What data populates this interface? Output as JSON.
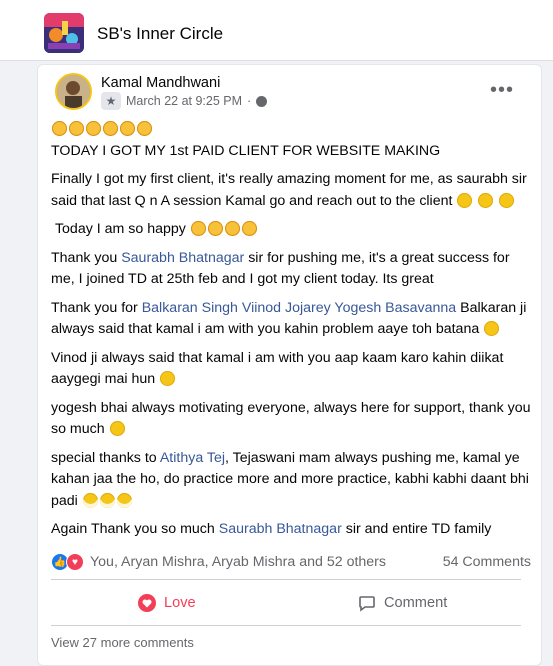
{
  "group": {
    "name": "SB's Inner Circle"
  },
  "post": {
    "author": "Kamal Mandhwani",
    "date": "March 22 at 9:25 PM",
    "meta_separator": "·",
    "more_label": "•••",
    "paragraphs": [
      {
        "emoji_line": "star-struck x6"
      },
      {
        "text": "TODAY I GOT MY 1st PAID CLIENT FOR WEBSITE MAKING"
      },
      {
        "text": "Finally I got my first client, it's really amazing moment for me, as saurabh sir said that last Q n A session Kamal go and reach out to the client"
      },
      {
        "text": "Today I am so happy"
      },
      {
        "prefix": "Thank you ",
        "link": "Saurabh Bhatnagar",
        "suffix": " sir for pushing me, it's a great success for me, I joined TD at 25th feb and I got my client today. Its great"
      },
      {
        "prefix": "Thank you for ",
        "link": "Balkaran Singh Viinod Jojarey Yogesh Basavanna",
        "suffix": " Balkaran ji always said that kamal i am with you kahin problem aaye toh batana"
      },
      {
        "text": "Vinod ji always said that kamal i am with you aap kaam karo kahin diikat aaygegi mai hun"
      },
      {
        "text": "yogesh bhai always motivating everyone, always here for support, thank you so much"
      },
      {
        "prefix": "special thanks to ",
        "link": "Atithya Tej",
        "suffix": ", Tejaswani mam always pushing me, kamal ye kahan jaa the ho, do practice more and more practice, kabhi kabhi daant bhi padi"
      },
      {
        "prefix": "Again Thank you so much ",
        "link": "Saurabh Bhatnagar",
        "suffix": " sir and entire TD family"
      }
    ]
  },
  "reactions": {
    "text": "You, Aryan Mishra, Aryab Mishra and 52 others",
    "comments": "54 Comments"
  },
  "actions": {
    "love_label": "Love",
    "comment_label": "Comment"
  },
  "footer": {
    "views": "View 27 more comments"
  },
  "colors": {
    "link": "#385898",
    "love": "#f33e58",
    "like": "#1877f2"
  }
}
